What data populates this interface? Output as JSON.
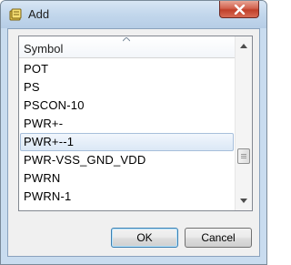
{
  "window": {
    "title": "Add"
  },
  "list": {
    "header": "Symbol",
    "items": [
      {
        "label": "POT",
        "selected": false
      },
      {
        "label": "PS",
        "selected": false
      },
      {
        "label": "PSCON-10",
        "selected": false
      },
      {
        "label": "PWR+-",
        "selected": false
      },
      {
        "label": "PWR+--1",
        "selected": true
      },
      {
        "label": "PWR-VSS_GND_VDD",
        "selected": false
      },
      {
        "label": "PWRN",
        "selected": false
      },
      {
        "label": "PWRN-1",
        "selected": false
      }
    ]
  },
  "buttons": {
    "ok": "OK",
    "cancel": "Cancel"
  },
  "icons": {
    "title": "dialog-book-icon",
    "close": "close-icon",
    "sort": "sort-ascending-icon",
    "scroll_up": "scroll-up-arrow-icon",
    "scroll_down": "scroll-down-arrow-icon"
  },
  "colors": {
    "titlebar": "#c2d7ec",
    "close_button": "#c7412c",
    "selection": "#dbe8f6"
  }
}
